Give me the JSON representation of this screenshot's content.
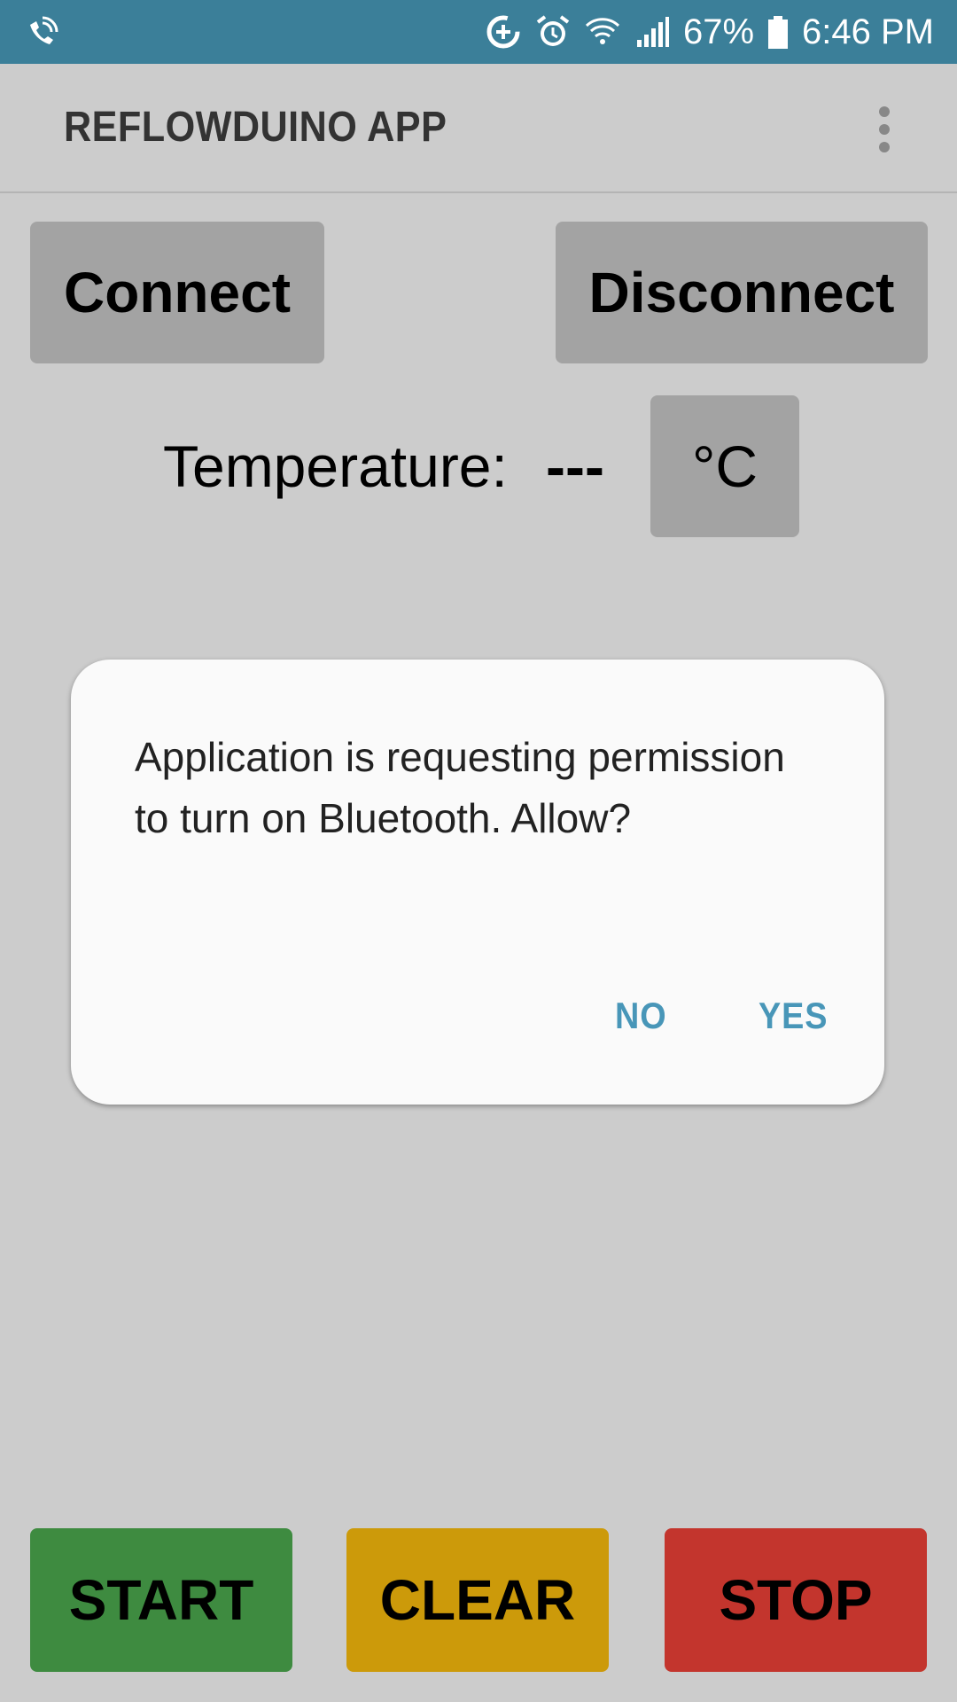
{
  "status_bar": {
    "battery": "67%",
    "time": "6:46 PM",
    "icons": [
      "wifi-calling-icon",
      "data-saver-icon",
      "alarm-icon",
      "wifi-icon",
      "signal-icon",
      "battery-icon"
    ]
  },
  "app_bar": {
    "title": "REFLOWDUINO APP",
    "menu_icon": "more-vert-icon"
  },
  "controls": {
    "connect_label": "Connect",
    "disconnect_label": "Disconnect"
  },
  "temperature": {
    "label": "Temperature:",
    "value": "---",
    "unit": "°C"
  },
  "dialog": {
    "message": "Application is requesting permission to turn on Bluetooth. Allow?",
    "no_label": "NO",
    "yes_label": "YES",
    "accent_color": "#4896b8"
  },
  "actions": {
    "start_label": "START",
    "clear_label": "CLEAR",
    "stop_label": "STOP",
    "start_color": "#3e8b40",
    "clear_color": "#cc9a0a",
    "stop_color": "#c3352d"
  }
}
